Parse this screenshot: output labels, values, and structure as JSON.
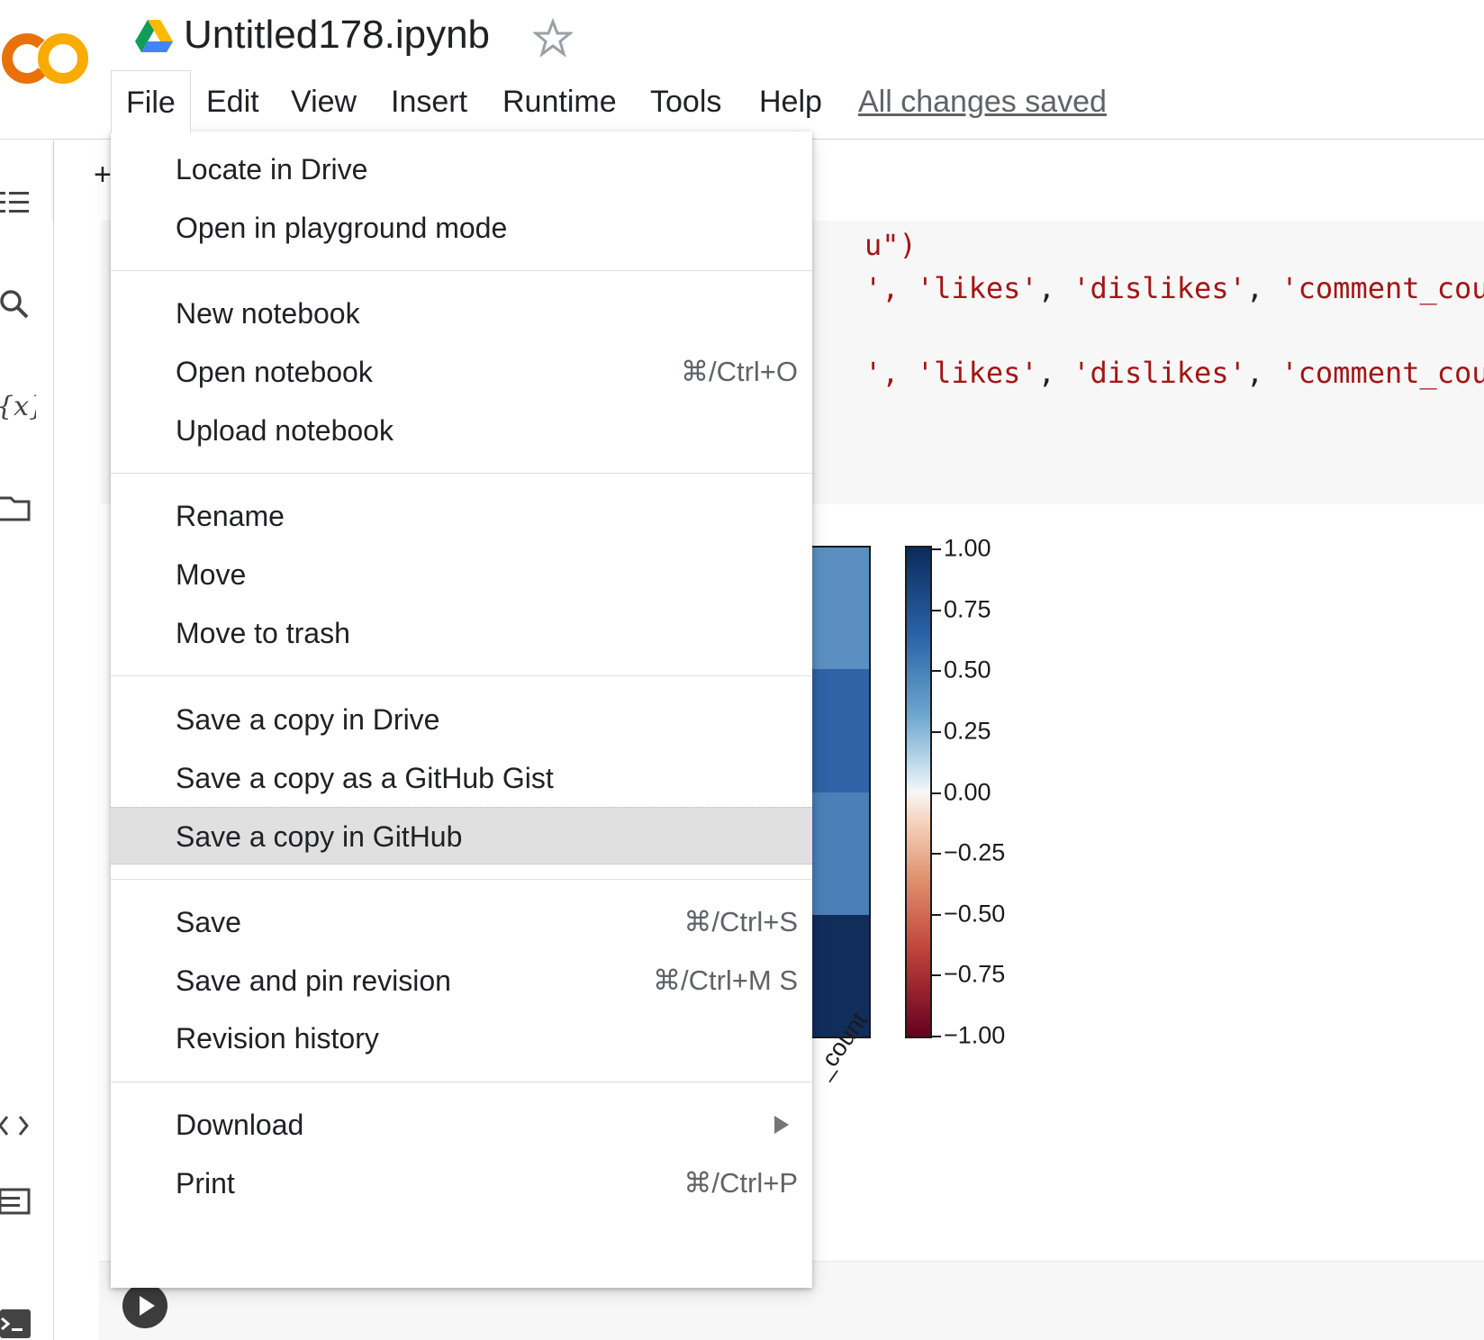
{
  "header": {
    "doc_title": "Untitled178.ipynb",
    "saved_status": "All changes saved"
  },
  "menubar": {
    "items": [
      "File",
      "Edit",
      "View",
      "Insert",
      "Runtime",
      "Tools",
      "Help"
    ]
  },
  "toolbar": {
    "add_label": "+"
  },
  "code": {
    "line1": "u\")",
    "line2_prefix": "',",
    "line2_s1": "'likes'",
    "line2_s2": "'dislikes'",
    "line2_s3": "'comment_cou",
    "line3_prefix": "',",
    "line3_s1": "'likes'",
    "line3_s2": "'dislikes'",
    "line3_s3": "'comment_cou",
    "comma": ","
  },
  "file_menu": {
    "items": [
      {
        "label": "Locate in Drive",
        "shortcut": ""
      },
      {
        "label": "Open in playground mode",
        "shortcut": ""
      },
      {
        "label": "New notebook",
        "shortcut": ""
      },
      {
        "label": "Open notebook",
        "shortcut": "⌘/Ctrl+O"
      },
      {
        "label": "Upload notebook",
        "shortcut": ""
      },
      {
        "label": "Rename",
        "shortcut": ""
      },
      {
        "label": "Move",
        "shortcut": ""
      },
      {
        "label": "Move to trash",
        "shortcut": ""
      },
      {
        "label": "Save a copy in Drive",
        "shortcut": ""
      },
      {
        "label": "Save a copy as a GitHub Gist",
        "shortcut": ""
      },
      {
        "label": "Save a copy in GitHub",
        "shortcut": "",
        "highlighted": true
      },
      {
        "label": "Save",
        "shortcut": "⌘/Ctrl+S"
      },
      {
        "label": "Save and pin revision",
        "shortcut": "⌘/Ctrl+M S"
      },
      {
        "label": "Revision history",
        "shortcut": ""
      },
      {
        "label": "Download",
        "shortcut": "",
        "submenu": true
      },
      {
        "label": "Print",
        "shortcut": "⌘/Ctrl+P"
      }
    ]
  },
  "chart_data": {
    "type": "heatmap",
    "title": "",
    "xlabel": "",
    "ylabel": "",
    "visible_x_tick_fragment": "_count",
    "colorbar": {
      "colormap": "RdBu",
      "range": [
        -1.0,
        1.0
      ],
      "ticks": [
        "1.00",
        "0.75",
        "0.50",
        "0.25",
        "0.00",
        "−0.25",
        "−0.50",
        "−0.75",
        "−1.00"
      ]
    },
    "visible_column_values": [
      0.6,
      0.8,
      0.7,
      1.0
    ],
    "visible_column_colors": [
      "#5b8fc2",
      "#2f62a6",
      "#4b7fb8",
      "#112d5c"
    ]
  },
  "colors": {
    "colab_orange": "#f9ab00",
    "colab_orange_dark": "#e8710a",
    "menu_highlight": "#e0e0e0",
    "code_string": "#a31515"
  },
  "icons": {
    "logo": "colab-logo",
    "drive": "google-drive-icon",
    "star": "star-outline-icon",
    "rail": [
      "toc-icon",
      "search-icon",
      "variables-icon",
      "folder-icon",
      "code-snippets-icon",
      "command-palette-icon",
      "terminal-icon"
    ],
    "run": "play-icon",
    "submenu": "submenu-arrow-icon"
  }
}
